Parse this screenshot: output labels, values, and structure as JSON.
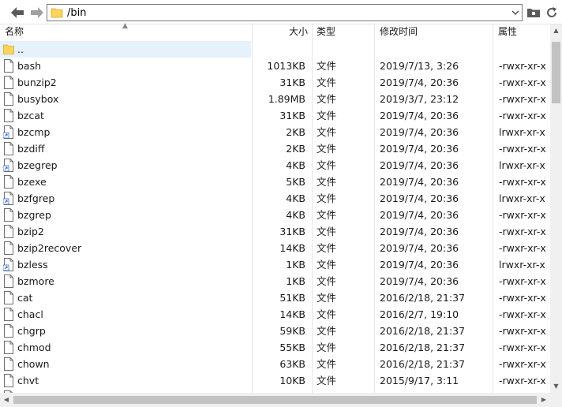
{
  "address": {
    "path": "/bin"
  },
  "icons": {
    "back": "arrow-left-icon",
    "forward": "arrow-right-icon",
    "dropdown": "chevron-down-icon",
    "new_folder": "folder-icon",
    "refresh": "refresh-icon"
  },
  "columns": {
    "name": "名称",
    "size": "大小",
    "type": "类型",
    "modified": "修改时间",
    "attr": "属性"
  },
  "files": [
    {
      "name": "..",
      "size": "",
      "type": "",
      "modified": "",
      "attr": "",
      "icon": "folder-icon",
      "selected": true
    },
    {
      "name": "bash",
      "size": "1013KB",
      "type": "文件",
      "modified": "2019/7/13, 3:26",
      "attr": "-rwxr-xr-x",
      "icon": "file-icon"
    },
    {
      "name": "bunzip2",
      "size": "31KB",
      "type": "文件",
      "modified": "2019/7/4, 20:36",
      "attr": "-rwxr-xr-x",
      "icon": "file-icon"
    },
    {
      "name": "busybox",
      "size": "1.89MB",
      "type": "文件",
      "modified": "2019/3/7, 23:12",
      "attr": "-rwxr-xr-x",
      "icon": "file-icon"
    },
    {
      "name": "bzcat",
      "size": "31KB",
      "type": "文件",
      "modified": "2019/7/4, 20:36",
      "attr": "-rwxr-xr-x",
      "icon": "file-icon"
    },
    {
      "name": "bzcmp",
      "size": "2KB",
      "type": "文件",
      "modified": "2019/7/4, 20:36",
      "attr": "lrwxr-xr-x",
      "icon": "link-file-icon"
    },
    {
      "name": "bzdiff",
      "size": "2KB",
      "type": "文件",
      "modified": "2019/7/4, 20:36",
      "attr": "-rwxr-xr-x",
      "icon": "file-icon"
    },
    {
      "name": "bzegrep",
      "size": "4KB",
      "type": "文件",
      "modified": "2019/7/4, 20:36",
      "attr": "lrwxr-xr-x",
      "icon": "link-file-icon"
    },
    {
      "name": "bzexe",
      "size": "5KB",
      "type": "文件",
      "modified": "2019/7/4, 20:36",
      "attr": "-rwxr-xr-x",
      "icon": "file-icon"
    },
    {
      "name": "bzfgrep",
      "size": "4KB",
      "type": "文件",
      "modified": "2019/7/4, 20:36",
      "attr": "lrwxr-xr-x",
      "icon": "link-file-icon"
    },
    {
      "name": "bzgrep",
      "size": "4KB",
      "type": "文件",
      "modified": "2019/7/4, 20:36",
      "attr": "-rwxr-xr-x",
      "icon": "file-icon"
    },
    {
      "name": "bzip2",
      "size": "31KB",
      "type": "文件",
      "modified": "2019/7/4, 20:36",
      "attr": "-rwxr-xr-x",
      "icon": "file-icon"
    },
    {
      "name": "bzip2recover",
      "size": "14KB",
      "type": "文件",
      "modified": "2019/7/4, 20:36",
      "attr": "-rwxr-xr-x",
      "icon": "file-icon"
    },
    {
      "name": "bzless",
      "size": "1KB",
      "type": "文件",
      "modified": "2019/7/4, 20:36",
      "attr": "lrwxr-xr-x",
      "icon": "link-file-icon"
    },
    {
      "name": "bzmore",
      "size": "1KB",
      "type": "文件",
      "modified": "2019/7/4, 20:36",
      "attr": "-rwxr-xr-x",
      "icon": "file-icon"
    },
    {
      "name": "cat",
      "size": "51KB",
      "type": "文件",
      "modified": "2016/2/18, 21:37",
      "attr": "-rwxr-xr-x",
      "icon": "file-icon"
    },
    {
      "name": "chacl",
      "size": "14KB",
      "type": "文件",
      "modified": "2016/2/7, 19:10",
      "attr": "-rwxr-xr-x",
      "icon": "file-icon"
    },
    {
      "name": "chgrp",
      "size": "59KB",
      "type": "文件",
      "modified": "2016/2/18, 21:37",
      "attr": "-rwxr-xr-x",
      "icon": "file-icon"
    },
    {
      "name": "chmod",
      "size": "55KB",
      "type": "文件",
      "modified": "2016/2/18, 21:37",
      "attr": "-rwxr-xr-x",
      "icon": "file-icon"
    },
    {
      "name": "chown",
      "size": "63KB",
      "type": "文件",
      "modified": "2016/2/18, 21:37",
      "attr": "-rwxr-xr-x",
      "icon": "file-icon"
    },
    {
      "name": "chvt",
      "size": "10KB",
      "type": "文件",
      "modified": "2015/9/17, 3:11",
      "attr": "-rwxr-xr-x",
      "icon": "file-icon"
    },
    {
      "name": "",
      "size": "",
      "type": "",
      "modified": "",
      "attr": "",
      "icon": "file-icon"
    }
  ]
}
